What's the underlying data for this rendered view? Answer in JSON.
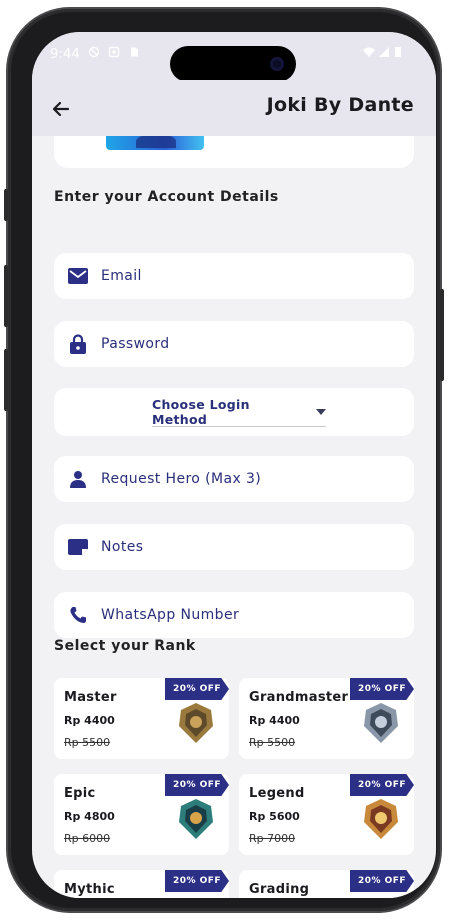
{
  "status_bar": {
    "time": "9:44"
  },
  "app_bar": {
    "title": "Joki By Dante"
  },
  "form": {
    "section_title": "Enter your Account Details",
    "email_placeholder": "Email",
    "password_placeholder": "Password",
    "login_method_label": "Choose Login Method",
    "hero_placeholder": "Request Hero (Max 3)",
    "notes_placeholder": "Notes",
    "whatsapp_placeholder": "WhatsApp Number"
  },
  "ranks": {
    "section_title": "Select your Rank",
    "items": [
      {
        "name": "Master",
        "price": "Rp 4400",
        "old_price": "Rp 5500",
        "badge": "20% OFF",
        "emblem": "master-emblem"
      },
      {
        "name": "Grandmaster",
        "price": "Rp 4400",
        "old_price": "Rp 5500",
        "badge": "20% OFF",
        "emblem": "grandmaster-emblem"
      },
      {
        "name": "Epic",
        "price": "Rp 4800",
        "old_price": "Rp 6000",
        "badge": "20% OFF",
        "emblem": "epic-emblem"
      },
      {
        "name": "Legend",
        "price": "Rp 5600",
        "old_price": "Rp 7000",
        "badge": "20% OFF",
        "emblem": "legend-emblem"
      },
      {
        "name": "Mythic",
        "price": "",
        "old_price": "",
        "badge": "20% OFF",
        "emblem": "mythic-emblem"
      },
      {
        "name": "Grading",
        "price": "",
        "old_price": "",
        "badge": "20% OFF",
        "emblem": "grading-emblem"
      }
    ]
  },
  "colors": {
    "accent": "#2b2f86",
    "field_text": "#2a2f7a",
    "background": "#f2f2f5",
    "app_bar": "#e7e6ee"
  }
}
